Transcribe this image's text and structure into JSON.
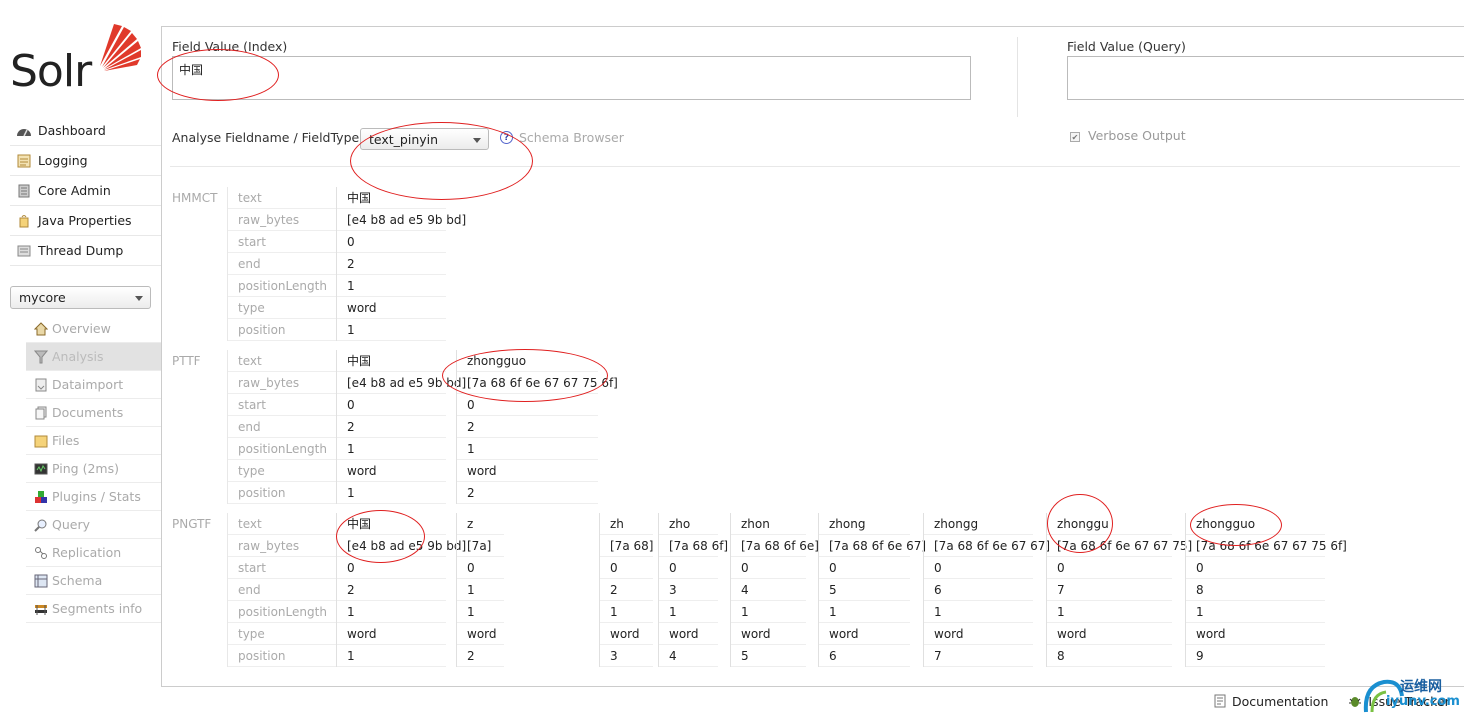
{
  "app": {
    "logo_text": "Solr"
  },
  "sidebar": {
    "items": [
      {
        "label": "Dashboard",
        "icon": "dashboard-icon"
      },
      {
        "label": "Logging",
        "icon": "logging-icon"
      },
      {
        "label": "Core Admin",
        "icon": "core-admin-icon"
      },
      {
        "label": "Java Properties",
        "icon": "java-icon"
      },
      {
        "label": "Thread Dump",
        "icon": "thread-dump-icon"
      }
    ],
    "core_selector": "mycore",
    "core_items": [
      {
        "label": "Overview",
        "icon": "house-icon"
      },
      {
        "label": "Analysis",
        "icon": "funnel-icon",
        "active": true
      },
      {
        "label": "Dataimport",
        "icon": "dataimport-icon"
      },
      {
        "label": "Documents",
        "icon": "documents-icon"
      },
      {
        "label": "Files",
        "icon": "folder-icon"
      },
      {
        "label": "Ping (2ms)",
        "icon": "ping-icon"
      },
      {
        "label": "Plugins / Stats",
        "icon": "plugins-icon"
      },
      {
        "label": "Query",
        "icon": "magnifier-icon"
      },
      {
        "label": "Replication",
        "icon": "replication-icon"
      },
      {
        "label": "Schema",
        "icon": "schema-icon"
      },
      {
        "label": "Segments info",
        "icon": "segments-icon"
      }
    ]
  },
  "form": {
    "index_label": "Field Value (Index)",
    "index_value": "中国",
    "query_label": "Field Value (Query)",
    "query_value": "",
    "fieldtype_label": "Analyse Fieldname / FieldType:",
    "fieldtype_value": "text_pinyin",
    "schema_browser": "Schema Browser",
    "verbose_label": "Verbose Output",
    "verbose_checked": true
  },
  "attributes": [
    "text",
    "raw_bytes",
    "start",
    "end",
    "positionLength",
    "type",
    "position"
  ],
  "stages": [
    {
      "name": "HMMCT",
      "tokens": [
        [
          "中国",
          "[e4 b8 ad e5 9b bd]",
          "0",
          "2",
          "1",
          "word",
          "1"
        ]
      ]
    },
    {
      "name": "PTTF",
      "tokens": [
        [
          "中国",
          "[e4 b8 ad e5 9b bd]",
          "0",
          "2",
          "1",
          "word",
          "1"
        ],
        [
          "zhongguo",
          "[7a 68 6f 6e 67 67 75 6f]",
          "0",
          "2",
          "1",
          "word",
          "2"
        ]
      ]
    },
    {
      "name": "PNGTF",
      "tokens": [
        [
          "中国",
          "[e4 b8 ad e5 9b bd]",
          "0",
          "2",
          "1",
          "word",
          "1"
        ],
        [
          "z",
          "[7a]",
          "0",
          "1",
          "1",
          "word",
          "2"
        ],
        [
          "zh",
          "[7a 68]",
          "0",
          "2",
          "1",
          "word",
          "3"
        ],
        [
          "zho",
          "[7a 68 6f]",
          "0",
          "3",
          "1",
          "word",
          "4"
        ],
        [
          "zhon",
          "[7a 68 6f 6e]",
          "0",
          "4",
          "1",
          "word",
          "5"
        ],
        [
          "zhong",
          "[7a 68 6f 6e 67]",
          "0",
          "5",
          "1",
          "word",
          "6"
        ],
        [
          "zhongg",
          "[7a 68 6f 6e 67 67]",
          "0",
          "6",
          "1",
          "word",
          "7"
        ],
        [
          "zhonggu",
          "[7a 68 6f 6e 67 67 75]",
          "0",
          "7",
          "1",
          "word",
          "8"
        ],
        [
          "zhongguo",
          "[7a 68 6f 6e 67 67 75 6f]",
          "0",
          "8",
          "1",
          "word",
          "9"
        ]
      ]
    }
  ],
  "footer": {
    "documentation": "Documentation",
    "issue_tracker": "Issue Tracker"
  },
  "watermark": {
    "cn": "运维网",
    "en": "iyunv.com"
  },
  "colors": {
    "annotation": "#e02020",
    "logo_red": "#e0392b"
  }
}
